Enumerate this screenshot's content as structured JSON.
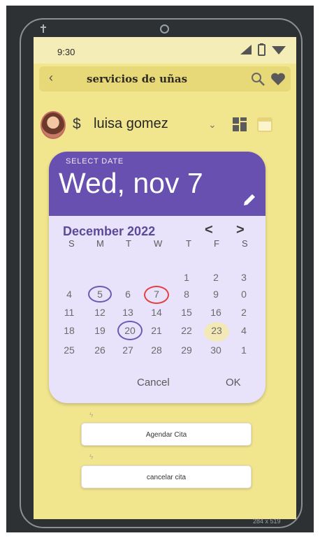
{
  "status": {
    "time": "9:30"
  },
  "appbar": {
    "back": "‹",
    "title": "servicios de uñas"
  },
  "user": {
    "currency": "$",
    "name": "luisa gomez"
  },
  "datepicker": {
    "select_label": "SELECT DATE",
    "selected_display": "Wed, nov 7",
    "month_year": "December 2022",
    "prev": "<",
    "next": ">",
    "weekdays": [
      "S",
      "M",
      "T",
      "W",
      "T",
      "F",
      "S"
    ],
    "weeks": [
      [
        "",
        "",
        "",
        "",
        "1",
        "2",
        "3"
      ],
      [
        "4",
        "5",
        "6",
        "7",
        "8",
        "9",
        "0"
      ],
      [
        "11",
        "12",
        "13",
        "14",
        "15",
        "16",
        "2"
      ],
      [
        "18",
        "19",
        "20",
        "21",
        "22",
        "23",
        "4"
      ],
      [
        "25",
        "26",
        "27",
        "28",
        "29",
        "30",
        "1"
      ]
    ],
    "cancel": "Cancel",
    "ok": "OK"
  },
  "actions": {
    "schedule": "Agendar Cita",
    "cancel": "cancelar cita"
  },
  "frame_label": "284 x 519",
  "colors": {
    "screen_bg": "#f1e58e",
    "dialog_header": "#6850b0",
    "dialog_bg": "#e8e2fb",
    "highlight_red": "#e2413e"
  }
}
